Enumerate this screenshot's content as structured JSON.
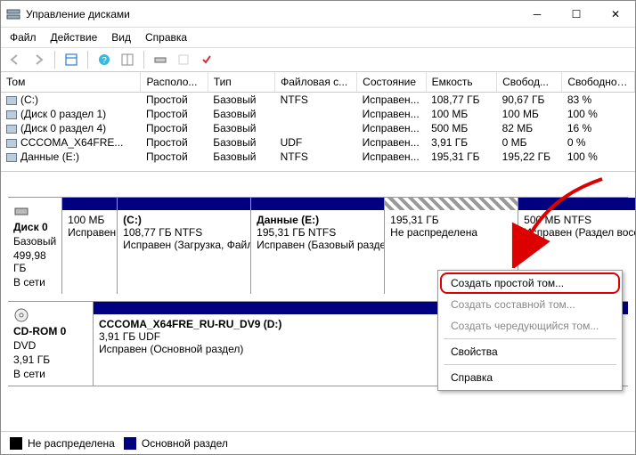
{
  "window": {
    "title": "Управление дисками"
  },
  "menu": {
    "file": "Файл",
    "action": "Действие",
    "view": "Вид",
    "help": "Справка"
  },
  "columns": [
    "Том",
    "Располо...",
    "Тип",
    "Файловая с...",
    "Состояние",
    "Емкость",
    "Свобод...",
    "Свободно %"
  ],
  "volumes": [
    {
      "name": "(C:)",
      "layout": "Простой",
      "type": "Базовый",
      "fs": "NTFS",
      "state": "Исправен...",
      "cap": "108,77 ГБ",
      "free": "90,67 ГБ",
      "pct": "83 %"
    },
    {
      "name": "(Диск 0 раздел 1)",
      "layout": "Простой",
      "type": "Базовый",
      "fs": "",
      "state": "Исправен...",
      "cap": "100 МБ",
      "free": "100 МБ",
      "pct": "100 %"
    },
    {
      "name": "(Диск 0 раздел 4)",
      "layout": "Простой",
      "type": "Базовый",
      "fs": "",
      "state": "Исправен...",
      "cap": "500 МБ",
      "free": "82 МБ",
      "pct": "16 %"
    },
    {
      "name": "CCCOMA_X64FRE...",
      "layout": "Простой",
      "type": "Базовый",
      "fs": "UDF",
      "state": "Исправен...",
      "cap": "3,91 ГБ",
      "free": "0 МБ",
      "pct": "0 %"
    },
    {
      "name": "Данные (E:)",
      "layout": "Простой",
      "type": "Базовый",
      "fs": "NTFS",
      "state": "Исправен...",
      "cap": "195,31 ГБ",
      "free": "195,22 ГБ",
      "pct": "100 %"
    }
  ],
  "disk0": {
    "name": "Диск 0",
    "type": "Базовый",
    "size": "499,98 ГБ",
    "status": "В сети",
    "p1": {
      "size": "100 МБ",
      "state": "Исправен"
    },
    "p2": {
      "title": "(C:)",
      "line2": "108,77 ГБ NTFS",
      "state": "Исправен (Загрузка, Файл подкачки)"
    },
    "p3": {
      "title": "Данные  (E:)",
      "line2": "195,31 ГБ NTFS",
      "state": "Исправен (Базовый раздел)"
    },
    "p4": {
      "size": "195,31 ГБ",
      "state": "Не распределена"
    },
    "p5": {
      "line2": "500 МБ NTFS",
      "state": "Исправен (Раздел восстановления)"
    }
  },
  "cdrom": {
    "name": "CD-ROM 0",
    "type": "DVD",
    "size": "3,91 ГБ",
    "status": "В сети",
    "p": {
      "title": "CCCOMA_X64FRE_RU-RU_DV9  (D:)",
      "line2": "3,91 ГБ UDF",
      "state": "Исправен (Основной раздел)"
    }
  },
  "legend": {
    "unalloc": "Не распределена",
    "primary": "Основной раздел"
  },
  "ctx": {
    "simple": "Создать простой том...",
    "spanned": "Создать составной том...",
    "striped": "Создать чередующийся том...",
    "props": "Свойства",
    "help": "Справка"
  }
}
